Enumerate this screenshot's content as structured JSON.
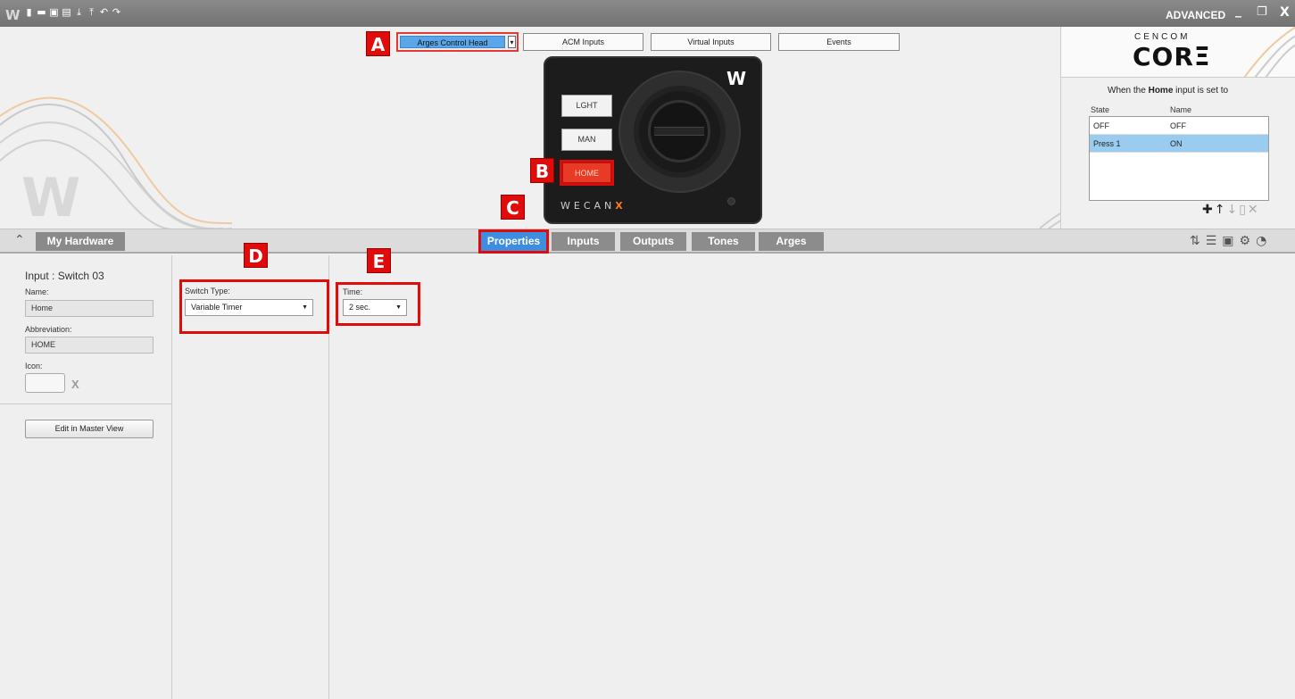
{
  "titlebar": {
    "logo": "W",
    "tools": [
      "new-icon",
      "open-icon",
      "save-icon",
      "print-icon",
      "download-icon",
      "upload-icon",
      "undo-icon",
      "redo-icon"
    ],
    "mode": "ADVANCED",
    "minimize": "_",
    "restore": "❐",
    "close": "X"
  },
  "top_buttons": {
    "device_select": "Arges Control Head",
    "acm_inputs": "ACM Inputs",
    "virtual_inputs": "Virtual Inputs",
    "events": "Events"
  },
  "markers": {
    "a": "A",
    "b": "B",
    "c": "C",
    "d": "D",
    "e": "E"
  },
  "device": {
    "logo": "W",
    "buttons": [
      "LGHT",
      "MAN",
      "HOME"
    ],
    "brand_prefix": "WECAN",
    "brand_x": "X"
  },
  "right_panel": {
    "cencom": "CENCOM",
    "core": "CORΞ",
    "when_prefix": "When the",
    "when_input": "Home",
    "when_suffix": "input is set to",
    "col_state": "State",
    "col_name": "Name",
    "rows": [
      {
        "state": "OFF",
        "name": "OFF"
      },
      {
        "state": "Press 1",
        "name": "ON"
      }
    ]
  },
  "tabs": {
    "my_hardware": "My Hardware",
    "items": [
      "Properties",
      "Inputs",
      "Outputs",
      "Tones",
      "Arges"
    ],
    "active": "Properties"
  },
  "left_panel": {
    "title": "Input : Switch 03",
    "name_label": "Name:",
    "name_value": "Home",
    "abbr_label": "Abbreviation:",
    "abbr_value": "HOME",
    "icon_label": "Icon:",
    "icon_clear": "X",
    "edit_button": "Edit in Master View"
  },
  "switch_type": {
    "label": "Switch Type:",
    "value": "Variable Timer"
  },
  "time": {
    "label": "Time:",
    "value": "2 sec."
  }
}
